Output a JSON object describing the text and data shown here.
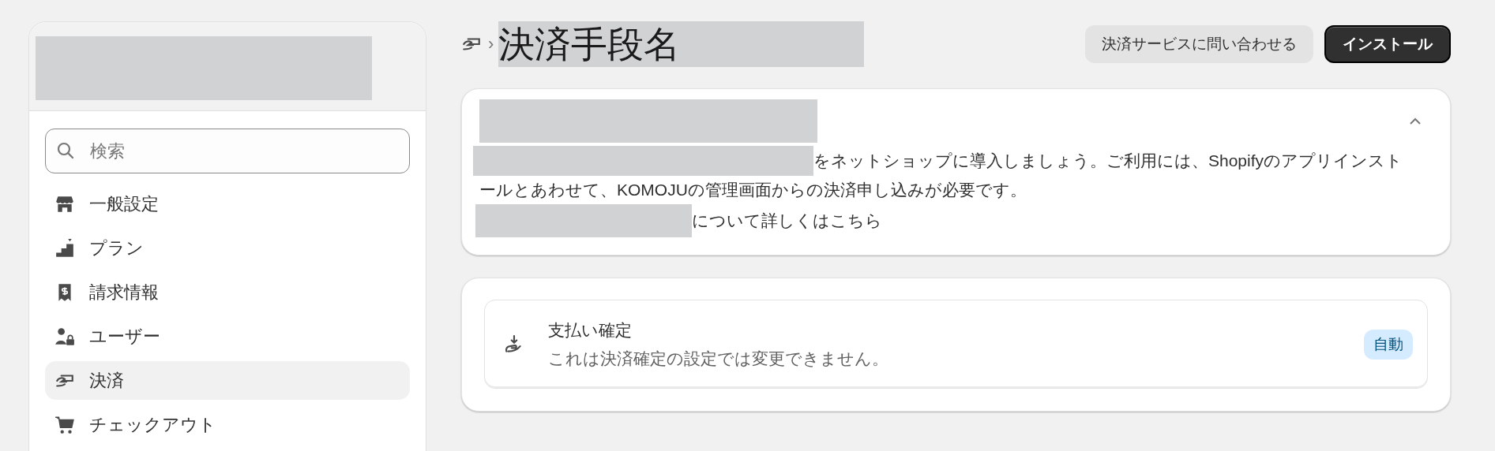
{
  "sidebar": {
    "search": {
      "placeholder": "検索"
    },
    "items": [
      {
        "label": "一般設定",
        "selected": false
      },
      {
        "label": "プラン",
        "selected": false
      },
      {
        "label": "請求情報",
        "selected": false
      },
      {
        "label": "ユーザー",
        "selected": false
      },
      {
        "label": "決済",
        "selected": true
      },
      {
        "label": "チェックアウト",
        "selected": false
      }
    ]
  },
  "header": {
    "chevron": "›",
    "title": "決済手段名",
    "buttons": [
      {
        "label": "決済サービスに問い合わせる",
        "kind": "secondary"
      },
      {
        "label": "インストール",
        "kind": "primary"
      }
    ]
  },
  "intro_card": {
    "expanded": true,
    "description_lines": [
      "をネットショップに導入しましょう。ご利用には、Shopifyのアプリインスト",
      "ールとあわせて、KOMOJUの管理画面からの決済申し込みが必要です。"
    ],
    "link_text": "について詳しくはこちら"
  },
  "settings_card": {
    "title": "支払い確定",
    "subtitle": "これは決済確定の設定では変更できません。",
    "badge": "自動"
  }
}
